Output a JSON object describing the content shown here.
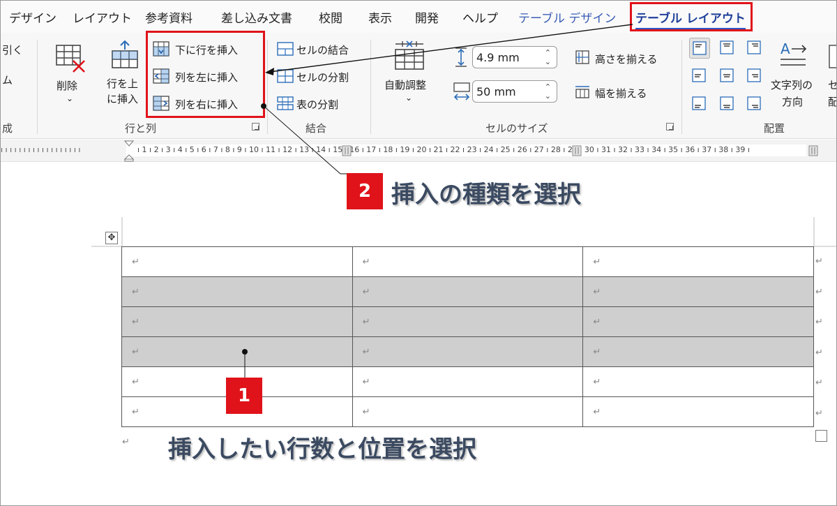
{
  "tabs": [
    {
      "label": "デザイン",
      "state": "normal"
    },
    {
      "label": "レイアウト",
      "state": "normal"
    },
    {
      "label": "参考資料",
      "state": "normal"
    },
    {
      "label": "差し込み文書",
      "state": "normal"
    },
    {
      "label": "校閲",
      "state": "normal"
    },
    {
      "label": "表示",
      "state": "normal"
    },
    {
      "label": "開発",
      "state": "normal"
    },
    {
      "label": "ヘルプ",
      "state": "normal"
    },
    {
      "label": "テーブル デザイン",
      "state": "contextual"
    },
    {
      "label": "テーブル レイアウト",
      "state": "active"
    }
  ],
  "ribbon": {
    "partial_left": {
      "line1": "引く",
      "line2": "ム",
      "group": "成"
    },
    "delete": {
      "label": "削除"
    },
    "insert_above": {
      "line1": "行を上",
      "line2": "に挿入"
    },
    "insert_below": {
      "label": "下に行を挿入"
    },
    "insert_left": {
      "label": "列を左に挿入"
    },
    "insert_right": {
      "label": "列を右に挿入"
    },
    "group_rows_cols": "行と列",
    "merge_cells": {
      "label": "セルの結合"
    },
    "split_cells": {
      "label": "セルの分割"
    },
    "split_table": {
      "label": "表の分割"
    },
    "group_merge": "結合",
    "autofit": {
      "label": "自動調整"
    },
    "height": {
      "value": "4.9 mm"
    },
    "width": {
      "value": "50 mm"
    },
    "distribute_rows": {
      "label": "高さを揃える"
    },
    "distribute_cols": {
      "label": "幅を揃える"
    },
    "group_cell_size": "セルのサイズ",
    "text_direction": {
      "line1": "文字列の",
      "line2": "方向"
    },
    "partial_right": {
      "line1": "セ",
      "line2": "配"
    },
    "group_alignment": "配置"
  },
  "ruler": {
    "left_ticks": "ı ı ı ı ı ı ı ı ı ı ı ı ı ı ı ı ı ı",
    "numbers": "ı 1 ı 2 ı 3 ı 4 ı 5 ı 6 ı 7 ı 8 ı 9 ı 10 ı 11 ı 12 ı 13 ı 14 ı 15 ı 16 ı 17 ı 18 ı 19 ı 20 ı 21 ı 22 ı 23 ı 24 ı 25 ı 26 ı 27 ı 28 ı 29 ı 30 ı 31 ı 32 ı 33 ı 34 ı 35 ı 36 ı 37 ı 38 ı 39 ı"
  },
  "callouts": {
    "step2": {
      "number": "2",
      "text": "挿入の種類を選択"
    },
    "step1": {
      "number": "1",
      "text": "挿入したい行数と位置を選択"
    }
  },
  "table": {
    "mark": "↵",
    "rows": [
      {
        "highlighted": false,
        "cells": [
          "↵",
          "↵",
          "↵"
        ]
      },
      {
        "highlighted": true,
        "cells": [
          "↵",
          "↵",
          "↵"
        ]
      },
      {
        "highlighted": true,
        "cells": [
          "↵",
          "↵",
          "↵"
        ]
      },
      {
        "highlighted": true,
        "cells": [
          "↵",
          "↵",
          "↵"
        ]
      },
      {
        "highlighted": false,
        "cells": [
          "↵",
          "↵",
          "↵"
        ]
      },
      {
        "highlighted": false,
        "cells": [
          "↵",
          "↵",
          "↵"
        ]
      }
    ]
  },
  "colors": {
    "accent_red": "#e0131a",
    "active_tab": "#1f3f9a",
    "selection": "#cfcfcf",
    "callout_text": "#3b4a61"
  },
  "move_handle_icon": "move-cross-icon"
}
